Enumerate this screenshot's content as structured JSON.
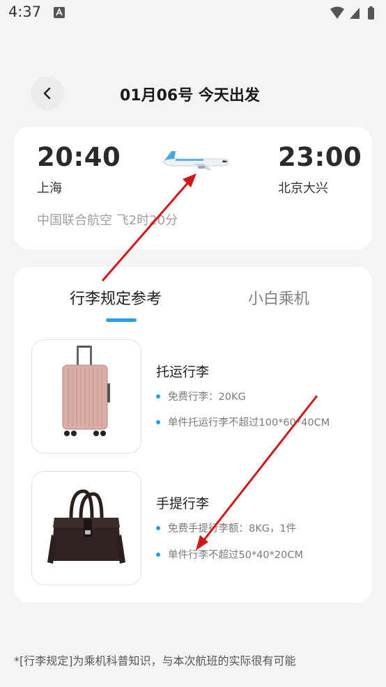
{
  "status_bar": {
    "time": "4:37"
  },
  "header": {
    "title": "01月06号 今天出发"
  },
  "flight": {
    "departure_time": "20:40",
    "departure_city": "上海",
    "arrival_time": "23:00",
    "arrival_city": "北京大兴",
    "airline_duration": "中国联合航空 飞2时20分"
  },
  "tabs": [
    {
      "label": "行李规定参考"
    },
    {
      "label": "小白乘机"
    }
  ],
  "baggage_items": [
    {
      "title": "托运行李",
      "bullets": [
        "免费行李：20KG",
        "单件托运行李不超过100*60*40CM"
      ]
    },
    {
      "title": "手提行李",
      "bullets": [
        "免费手提行李额：8KG，1件",
        "单件行李不超过50*40*20CM"
      ]
    }
  ],
  "footer": {
    "note": "*[行李规定]为乘机科普知识，与本次航班的实际很有可能"
  },
  "colors": {
    "accent": "#2a9de0",
    "annotation_arrow": "#d01818"
  }
}
